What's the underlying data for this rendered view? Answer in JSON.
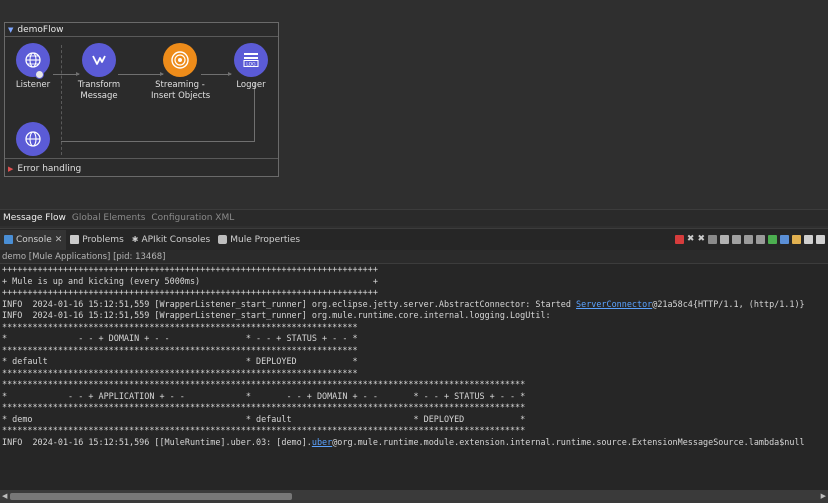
{
  "flow": {
    "name": "demoFlow",
    "error_handling": "Error handling",
    "nodes": {
      "listener": "Listener",
      "transform": "Transform\nMessage",
      "streaming": "Streaming -\nInsert Objects",
      "logger": "Logger",
      "logger_icon_text": "LOG"
    }
  },
  "editor_tabs": [
    "Message Flow",
    "Global Elements",
    "Configuration XML"
  ],
  "view_tabs": {
    "console": "Console",
    "problems": "Problems",
    "apikit": "APIkit Consoles",
    "mule_properties": "Mule Properties"
  },
  "console_title": "demo [Mule Applications]  [pid: 13468]",
  "console": {
    "line1": "++++++++++++++++++++++++++++++++++++++++++++++++++++++++++++++++++++++++++",
    "line2": "+ Mule is up and kicking (every 5000ms)                                  +",
    "line3": "++++++++++++++++++++++++++++++++++++++++++++++++++++++++++++++++++++++++++",
    "line4_pre": "INFO  2024-01-16 15:12:51,559 [WrapperListener_start_runner] org.eclipse.jetty.server.AbstractConnector: Started ",
    "line4_link": "ServerConnector",
    "line4_post": "@21a58c4{HTTP/1.1, (http/1.1)}",
    "line5": "INFO  2024-01-16 15:12:51,559 [WrapperListener_start_runner] org.mule.runtime.core.internal.logging.LogUtil:",
    "line6": "**********************************************************************",
    "line7": "*              - - + DOMAIN + - -               * - - + STATUS + - - *",
    "line8": "**********************************************************************",
    "line9": "* default                                       * DEPLOYED           *",
    "line10": "**********************************************************************",
    "line11": "",
    "line12": "*******************************************************************************************************",
    "line13": "*            - - + APPLICATION + - -            *       - - + DOMAIN + - -       * - - + STATUS + - - *",
    "line14": "*******************************************************************************************************",
    "line15": "* demo                                          * default                        * DEPLOYED           *",
    "line16": "*******************************************************************************************************",
    "line17": "",
    "line18_pre": "INFO  2024-01-16 15:12:51,596 [[MuleRuntime].uber.03: [demo].",
    "line18_link": "uber",
    "line18_post": "@org.mule.runtime.module.extension.internal.runtime.source.ExtensionMessageSource.lambda$null"
  },
  "colors": {
    "connector_purple": "#5b5bd6",
    "streaming_orange": "#ee8c1a",
    "link_blue": "#5aa2ff"
  }
}
